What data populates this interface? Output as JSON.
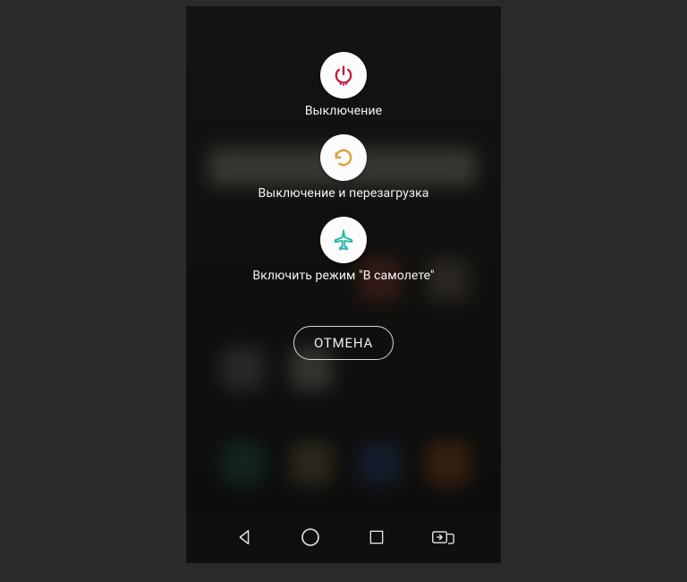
{
  "power_menu": {
    "options": [
      {
        "label": "Выключение",
        "icon": "power-icon"
      },
      {
        "label": "Выключение и перезагрузка",
        "icon": "restart-icon"
      },
      {
        "label": "Включить режим \"В самолете\"",
        "icon": "airplane-icon"
      }
    ],
    "cancel_label": "ОТМЕНА"
  },
  "nav": {
    "back": "back-icon",
    "home": "home-icon",
    "recent": "recent-icon",
    "extra": "dual-window-icon"
  },
  "colors": {
    "power": "#c3193f",
    "restart": "#d8a23e",
    "airplane": "#2fb9a9",
    "nav_stroke": "#e6e6e6"
  }
}
